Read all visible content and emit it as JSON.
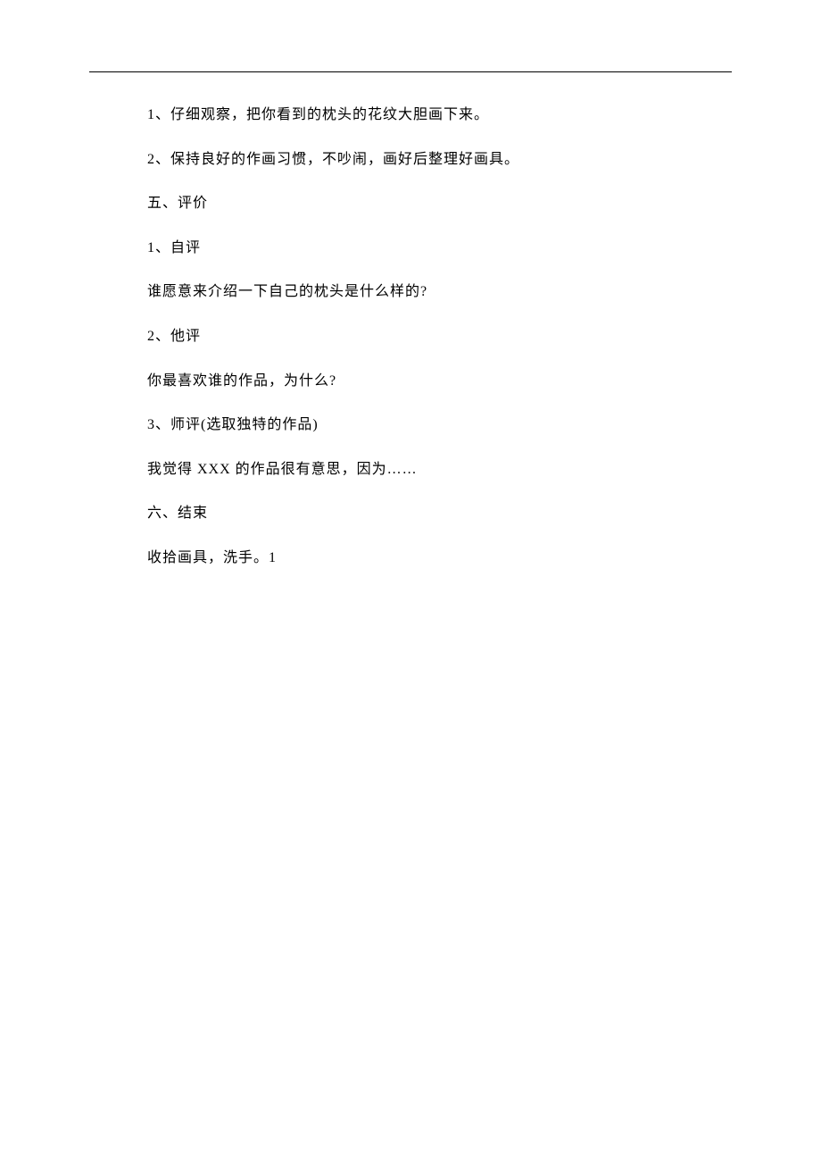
{
  "lines": [
    "1、仔细观察，把你看到的枕头的花纹大胆画下来。",
    "2、保持良好的作画习惯，不吵闹，画好后整理好画具。",
    "五、评价",
    "1、自评",
    "谁愿意来介绍一下自己的枕头是什么样的?",
    "2、他评",
    "你最喜欢谁的作品，为什么?",
    "3、师评(选取独特的作品)",
    "我觉得 XXX 的作品很有意思，因为……",
    "六、结束",
    "收拾画具，洗手。1"
  ]
}
